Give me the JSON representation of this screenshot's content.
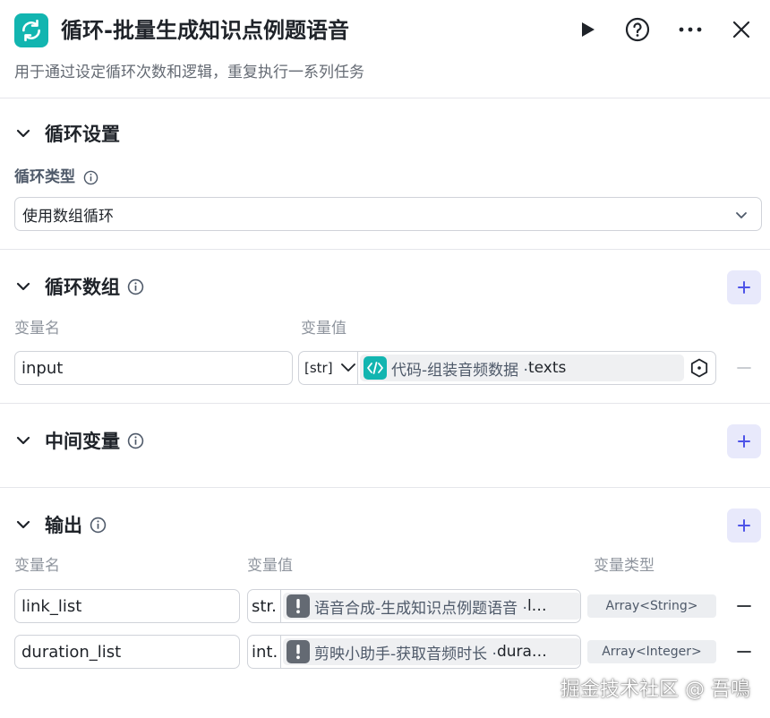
{
  "header": {
    "title": "循环-批量生成知识点例题语音",
    "description": "用于通过设定循环次数和逻辑，重复执行一系列任务",
    "icon": "loop-icon",
    "accent": "#12b5b0"
  },
  "loop_settings": {
    "title": "循环设置",
    "type_label": "循环类型",
    "type_value": "使用数组循环"
  },
  "loop_array": {
    "title": "循环数组",
    "col_name": "变量名",
    "col_value": "变量值",
    "rows": [
      {
        "name": "input",
        "type": "[str]",
        "ref_source": "代码-组装音频数据 · ",
        "ref_field": "texts"
      }
    ]
  },
  "intermediate": {
    "title": "中间变量"
  },
  "output": {
    "title": "输出",
    "col_name": "变量名",
    "col_value": "变量值",
    "col_type": "变量类型",
    "rows": [
      {
        "name": "link_list",
        "type": "str.",
        "ref_source": "语音合成-生成知识点例题语音 · ",
        "ref_field": "l…",
        "var_type": "Array<String>"
      },
      {
        "name": "duration_list",
        "type": "int.",
        "ref_source": "剪映小助手-获取音频时长 · ",
        "ref_field": "dura…",
        "var_type": "Array<Integer>"
      }
    ]
  },
  "watermark": "掘金技术社区 @ 吾鳴"
}
